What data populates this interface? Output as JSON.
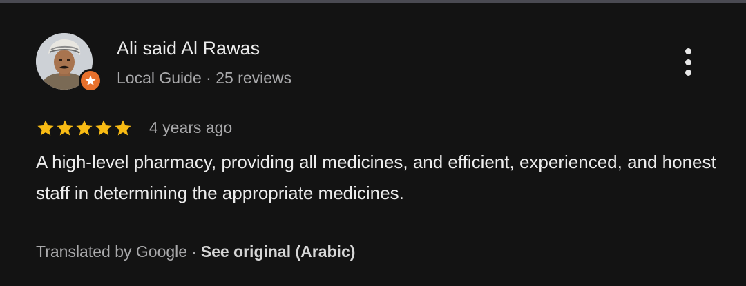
{
  "review": {
    "author_name": "Ali said Al Rawas",
    "author_badge": "Local Guide",
    "separator": "·",
    "review_count": "25 reviews",
    "rating": 5,
    "rating_max": 5,
    "date": "4 years ago",
    "text": "A high-level pharmacy, providing all medicines, and efficient, experienced, and honest staff in determining the appropriate medicines.",
    "translated_by": "Translated by Google",
    "see_original": "See original (Arabic)"
  },
  "icons": {
    "more": "more-vert-icon",
    "star": "star-icon",
    "badge": "local-guide-star-icon"
  },
  "colors": {
    "background": "#131313",
    "star": "#f8bb14",
    "badge": "#e8712c",
    "primary_text": "#ececec",
    "secondary_text": "#a9a9ab"
  }
}
